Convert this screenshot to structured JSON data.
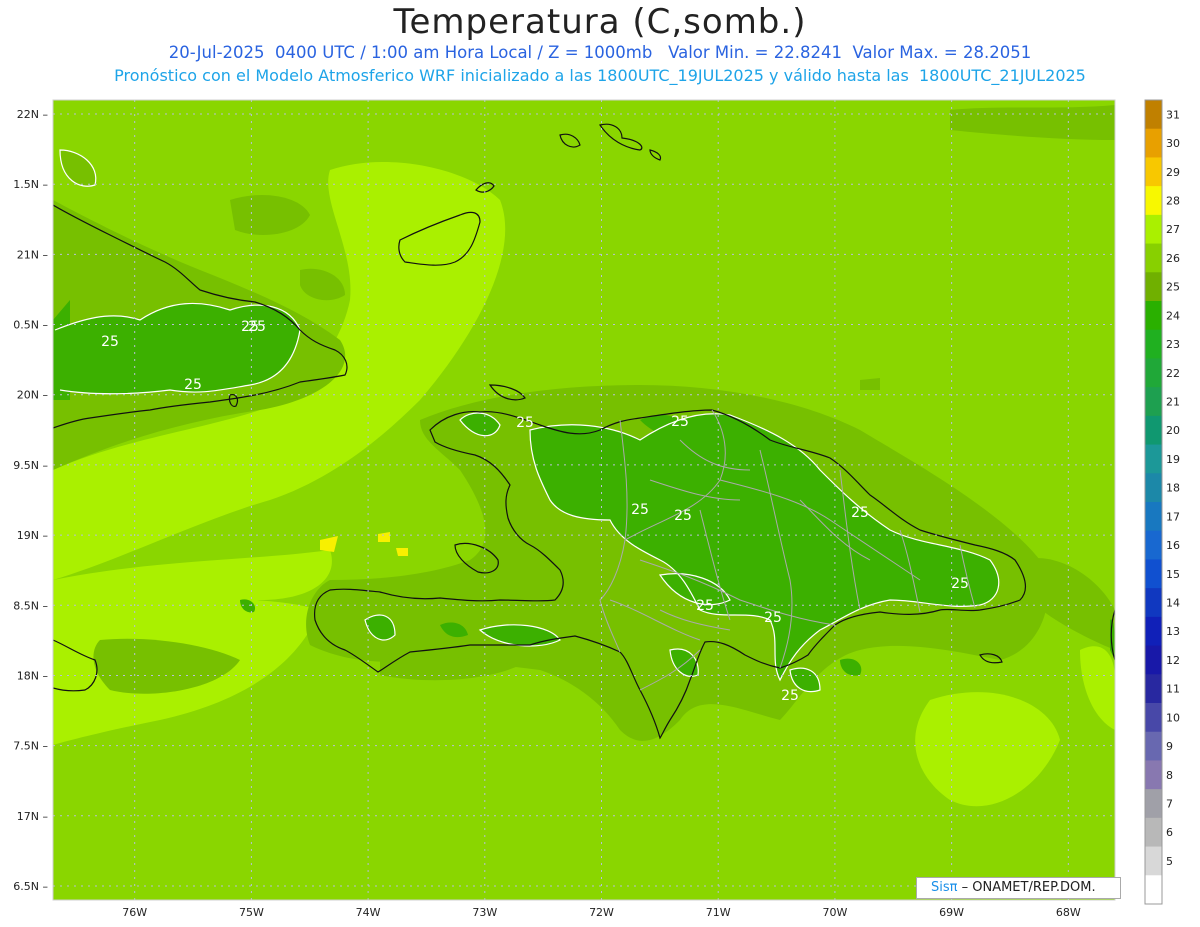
{
  "header": {
    "title": "Temperatura (C,somb.)",
    "line1": "20-Jul-2025  0400 UTC / 1:00 am Hora Local / Z = 1000mb   Valor Min. = 22.8241  Valor Max. = 28.2051",
    "line2": "Pronóstico con el Modelo Atmosferico WRF inicializado a las 1800UTC_19JUL2025 y válido hasta las  1800UTC_21JUL2025"
  },
  "map": {
    "lon_range": [
      -76.7,
      -67.6
    ],
    "lat_range": [
      16.4,
      22.1
    ],
    "lat_ticks": [
      "22N",
      "1.5N",
      "21N",
      "0.5N",
      "20N",
      "9.5N",
      "19N",
      "8.5N",
      "18N",
      "7.5N",
      "17N",
      "6.5N"
    ],
    "lon_ticks": [
      "76W",
      "75W",
      "74W",
      "73W",
      "72W",
      "71W",
      "70W",
      "69W",
      "68W"
    ],
    "contour_labels": [
      "25",
      "25",
      "25",
      "25",
      "25",
      "25",
      "25",
      "25",
      "25",
      "25",
      "25",
      "25",
      "25"
    ],
    "colors": {
      "base": "#8ad600",
      "warm": "#aaf000",
      "mild": "#77c000",
      "green24": "#3cb000",
      "coast": "#111111",
      "border": "#aaaaaa",
      "contour": "#ffffff"
    }
  },
  "colorbar": {
    "labels": [
      "31",
      "30",
      "29",
      "28",
      "27",
      "26",
      "25",
      "24",
      "23",
      "22",
      "21",
      "20",
      "19",
      "18",
      "17",
      "16",
      "15",
      "14",
      "13",
      "12",
      "11",
      "10",
      "9",
      "8",
      "7",
      "6",
      "5"
    ],
    "colors": [
      "#c08000",
      "#e8a000",
      "#f8c800",
      "#f8f800",
      "#aaf000",
      "#88d000",
      "#70b000",
      "#2ab000",
      "#20b020",
      "#20a838",
      "#1ea050",
      "#109870",
      "#1c9898",
      "#1c88a8",
      "#1878c0",
      "#1868d0",
      "#1050d0",
      "#1038c0",
      "#1020b8",
      "#1818a8",
      "#2828a0",
      "#4848a8",
      "#6868b0",
      "#8878b0",
      "#a0a0a8",
      "#b8b8b8",
      "#d8d8d8",
      "#ffffff"
    ]
  },
  "credit": {
    "brand": "Sis",
    "pi": "π",
    "rest": " – ONAMET/REP.DOM."
  }
}
